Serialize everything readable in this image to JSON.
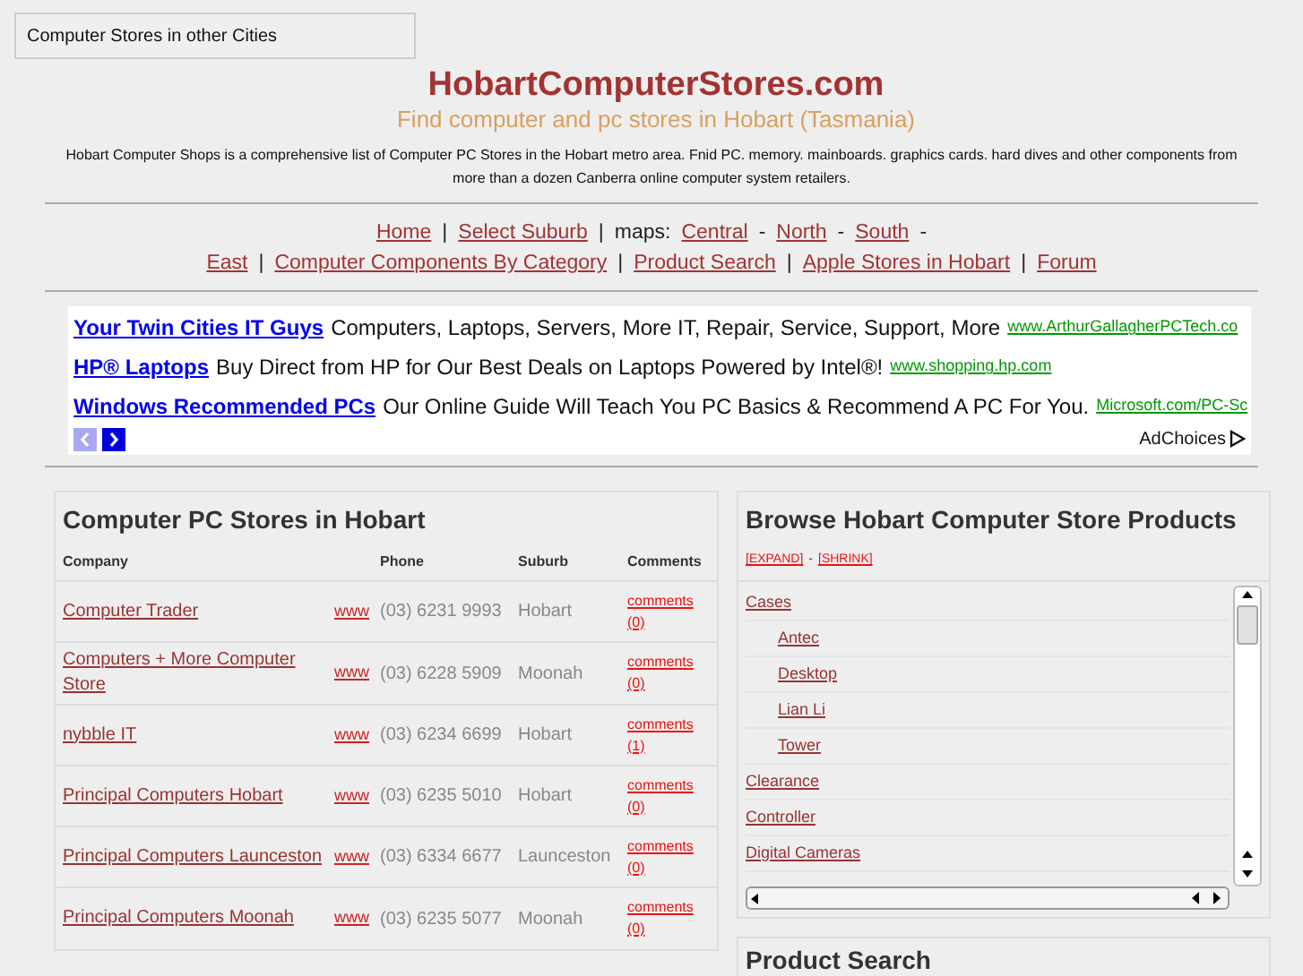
{
  "other_cities": "Computer Stores in other Cities",
  "site_title": "HobartComputerStores.com",
  "tagline": "Find computer and pc stores in Hobart (Tasmania)",
  "intro": "Hobart Computer Shops is a comprehensive list of Computer PC Stores in the Hobart metro area. Fnid PC. memory. mainboards. graphics cards. hard dives and other components from more than a dozen Canberra online computer system retailers.",
  "nav": [
    {
      "kind": "link",
      "text": "Home"
    },
    {
      "kind": "sep",
      "text": "|"
    },
    {
      "kind": "link",
      "text": "Select Suburb"
    },
    {
      "kind": "sep",
      "text": "|"
    },
    {
      "kind": "label",
      "text": "maps:"
    },
    {
      "kind": "link",
      "text": "Central"
    },
    {
      "kind": "sep",
      "text": "-"
    },
    {
      "kind": "link",
      "text": "North"
    },
    {
      "kind": "sep",
      "text": "-"
    },
    {
      "kind": "link",
      "text": "South"
    },
    {
      "kind": "sep",
      "text": "-"
    },
    {
      "kind": "link",
      "text": "East"
    },
    {
      "kind": "sep",
      "text": "|"
    },
    {
      "kind": "link",
      "text": "Computer Components By Category"
    },
    {
      "kind": "sep",
      "text": "|"
    },
    {
      "kind": "link",
      "text": "Product Search"
    },
    {
      "kind": "sep",
      "text": "|"
    },
    {
      "kind": "link",
      "text": "Apple Stores in Hobart"
    },
    {
      "kind": "sep",
      "text": "|"
    },
    {
      "kind": "link",
      "text": "Forum"
    }
  ],
  "ads": [
    {
      "title": "Your Twin Cities IT Guys",
      "text": "Computers, Laptops, Servers, More IT, Repair, Service, Support, More",
      "url": "www.ArthurGallagherPCTech.co"
    },
    {
      "title": "HP® Laptops",
      "text": "Buy Direct from HP for Our Best Deals on Laptops Powered by Intel®!",
      "url": "www.shopping.hp.com"
    },
    {
      "title": "Windows Recommended PCs",
      "text": "Our Online Guide Will Teach You PC Basics & Recommend A PC For You.",
      "url": "Microsoft.com/PC-Sc"
    }
  ],
  "ad_choices": "AdChoices",
  "stores": {
    "title": "Computer PC Stores in Hobart",
    "columns": [
      "Company",
      "Phone",
      "Suburb",
      "Comments"
    ],
    "rows": [
      {
        "company": "Computer Trader",
        "www": "www",
        "phone": "(03) 6231 9993",
        "suburb": "Hobart",
        "comments": "comments (0)"
      },
      {
        "company": "Computers + More Computer Store",
        "www": "www",
        "phone": "(03) 6228 5909",
        "suburb": "Moonah",
        "comments": "comments (0)"
      },
      {
        "company": "nybble IT",
        "www": "www",
        "phone": "(03) 6234 6699",
        "suburb": "Hobart",
        "comments": "comments (1)"
      },
      {
        "company": "Principal Computers Hobart",
        "www": "www",
        "phone": "(03) 6235 5010",
        "suburb": "Hobart",
        "comments": "comments (0)"
      },
      {
        "company": "Principal Computers Launceston",
        "www": "www",
        "phone": "(03) 6334 6677",
        "suburb": "Launceston",
        "comments": "comments (0)"
      },
      {
        "company": "Principal Computers Moonah",
        "www": "www",
        "phone": "(03) 6235 5077",
        "suburb": "Moonah",
        "comments": "comments (0)"
      }
    ]
  },
  "browse": {
    "title": "Browse Hobart Computer Store Products",
    "expand": "[EXPAND]",
    "dash": "-",
    "shrink": "[SHRINK]",
    "tree": [
      {
        "label": "Cases",
        "children": [
          {
            "label": "Antec"
          },
          {
            "label": "Desktop"
          },
          {
            "label": "Lian Li"
          },
          {
            "label": "Tower"
          }
        ]
      },
      {
        "label": "Clearance"
      },
      {
        "label": "Controller"
      },
      {
        "label": "Digital Cameras"
      }
    ]
  },
  "product_search": {
    "title": "Product Search"
  }
}
